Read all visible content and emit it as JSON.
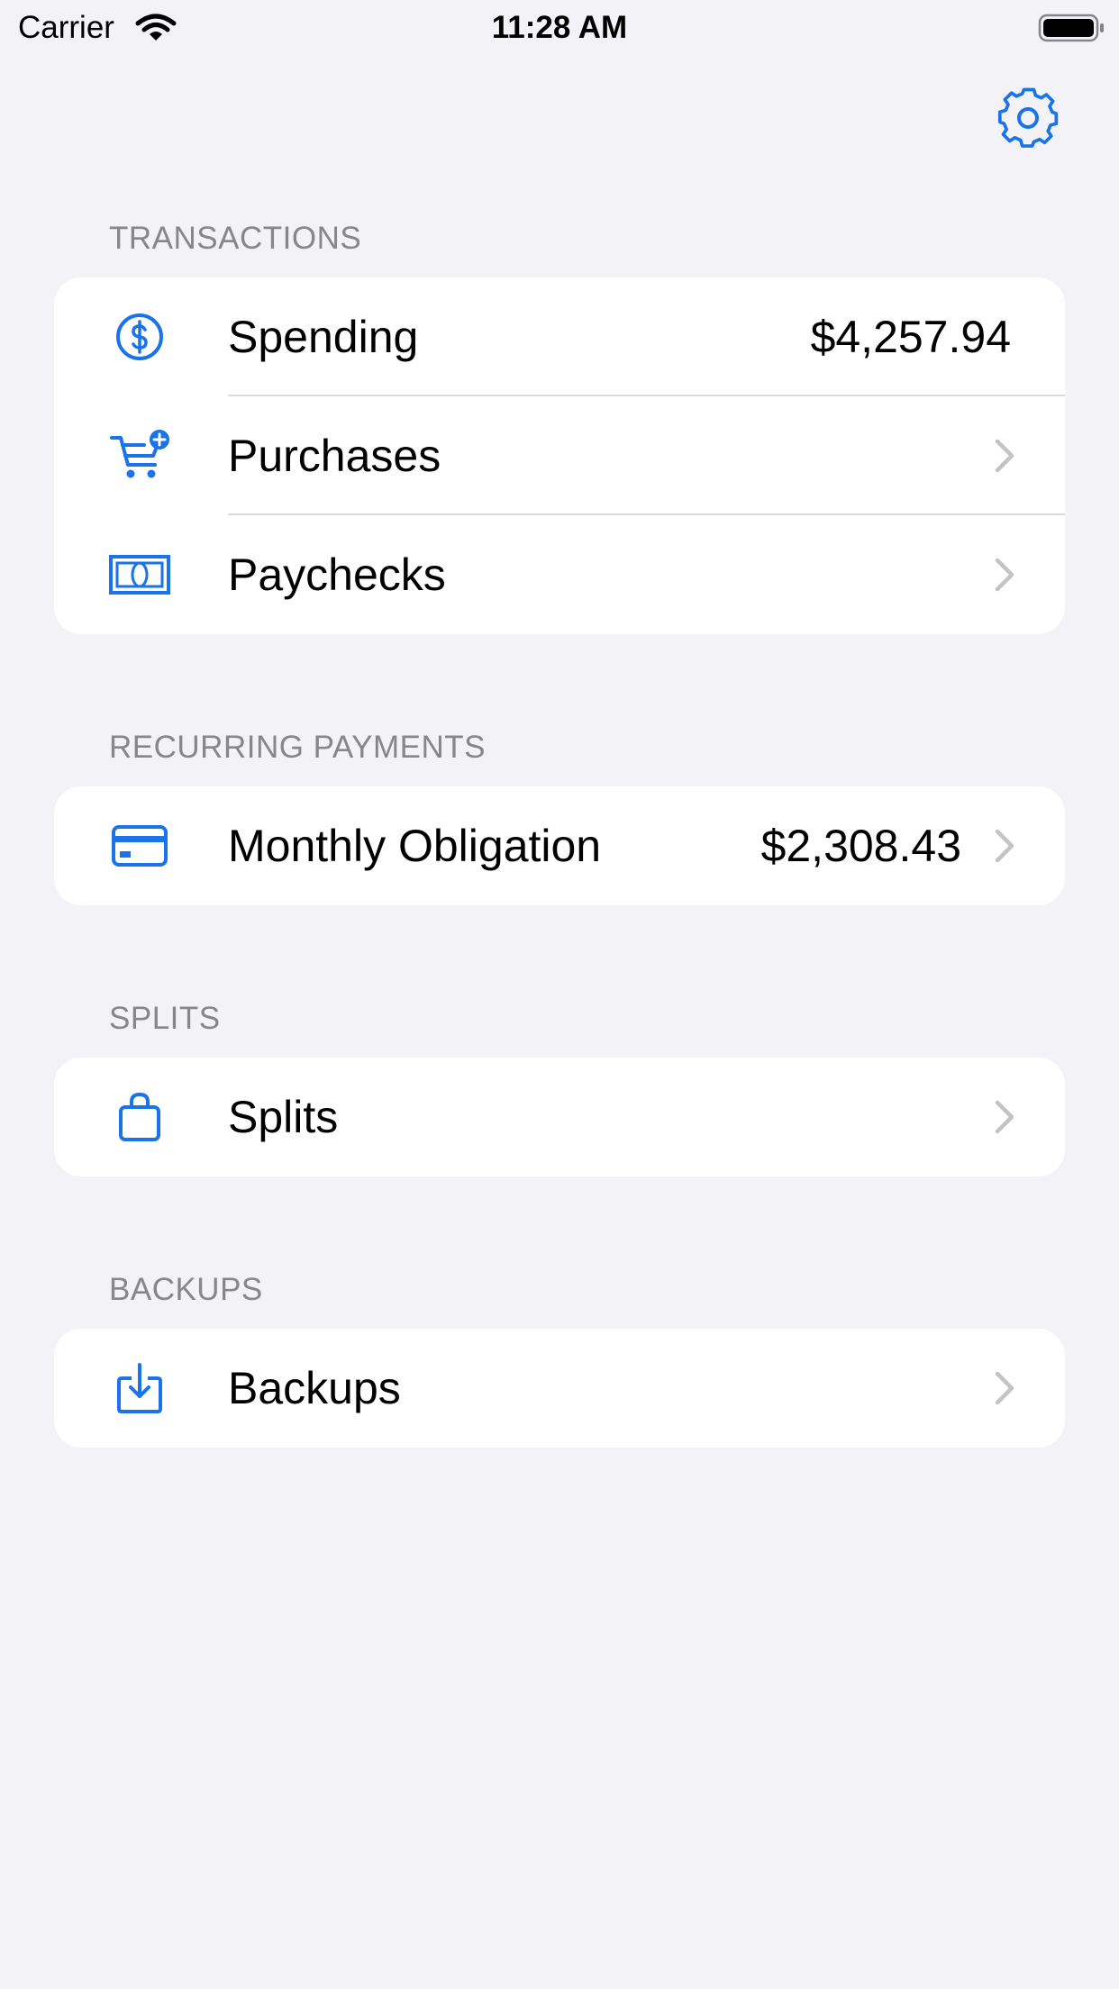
{
  "status_bar": {
    "carrier": "Carrier",
    "time": "11:28 AM"
  },
  "colors": {
    "accent": "#1a73e8",
    "background": "#f2f2f7",
    "section_header": "#86868b",
    "separator": "#dadade",
    "chevron": "#c4c4c7"
  },
  "header": {
    "settings_icon": "gear-icon"
  },
  "sections": {
    "transactions": {
      "title": "TRANSACTIONS",
      "items": [
        {
          "label": "Spending",
          "value": "$4,257.94",
          "icon": "dollar-circle-icon"
        },
        {
          "label": "Purchases",
          "icon": "cart-plus-icon"
        },
        {
          "label": "Paychecks",
          "icon": "banknote-icon"
        }
      ]
    },
    "recurring": {
      "title": "RECURRING PAYMENTS",
      "items": [
        {
          "label": "Monthly Obligation",
          "value": "$2,308.43",
          "icon": "credit-card-icon"
        }
      ]
    },
    "splits": {
      "title": "SPLITS",
      "items": [
        {
          "label": "Splits",
          "icon": "bag-icon"
        }
      ]
    },
    "backups": {
      "title": "BACKUPS",
      "items": [
        {
          "label": "Backups",
          "icon": "tray-download-icon"
        }
      ]
    }
  }
}
